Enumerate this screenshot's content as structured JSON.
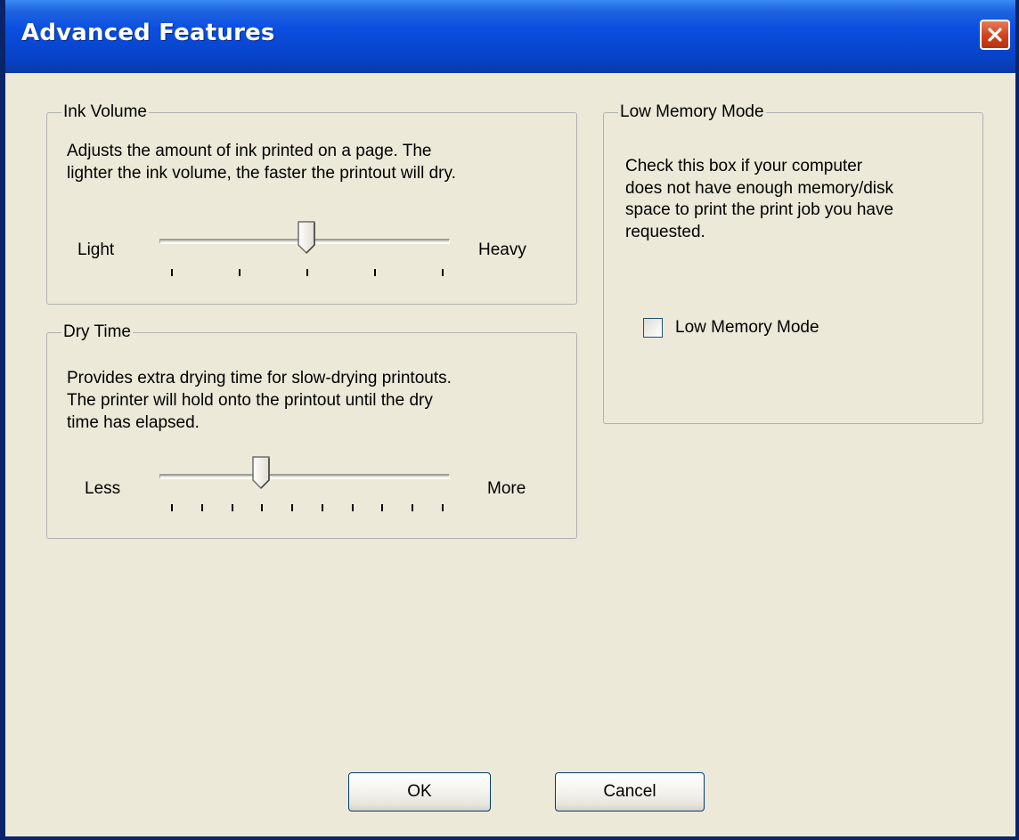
{
  "window": {
    "title": "Advanced Features",
    "close_icon": "close-x-icon"
  },
  "ink_volume": {
    "label": "Ink Volume",
    "description_lines": [
      "Adjusts the amount of ink printed on a page. The",
      "lighter the ink volume, the faster the printout will dry."
    ],
    "min_label": "Light",
    "max_label": "Heavy",
    "tick_count": 5,
    "value_index": 2
  },
  "dry_time": {
    "label": "Dry Time",
    "description_lines": [
      "Provides extra drying time for slow-drying printouts.",
      "The printer will hold onto the printout until the dry",
      "time has elapsed."
    ],
    "min_label": "Less",
    "max_label": "More",
    "tick_count": 10,
    "value_index": 3
  },
  "low_memory": {
    "label": "Low Memory Mode",
    "description_lines": [
      "Check this box if your computer",
      "does not have enough memory/disk",
      "space to print the print job you have",
      "requested."
    ],
    "checkbox_label": "Low Memory Mode",
    "checked": false
  },
  "buttons": {
    "ok": "OK",
    "cancel": "Cancel"
  }
}
